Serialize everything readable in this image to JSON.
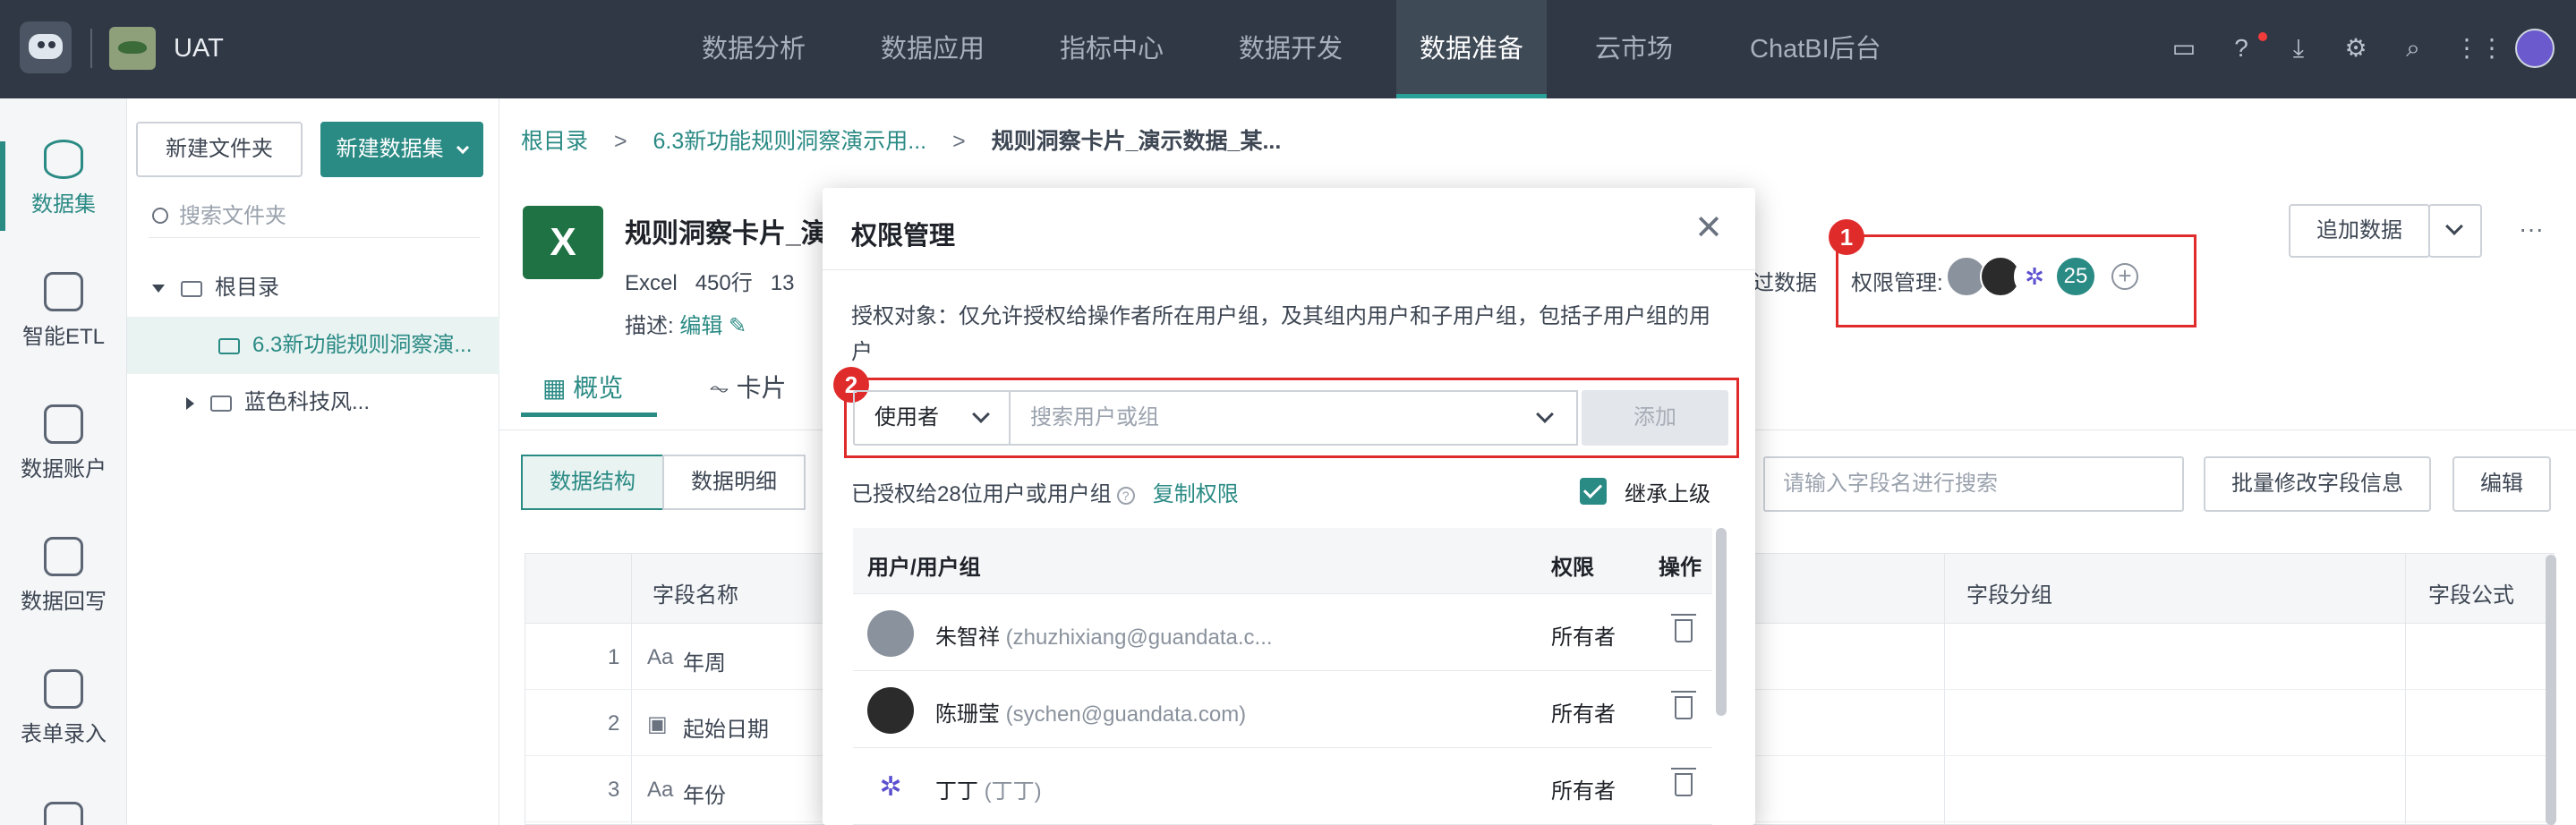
{
  "topbar": {
    "app_name": "UAT",
    "nav": [
      "数据分析",
      "数据应用",
      "指标中心",
      "数据开发",
      "数据准备",
      "云市场",
      "ChatBI后台"
    ],
    "active_nav": "数据准备",
    "icons": [
      "monitor-icon",
      "help-icon",
      "download-icon",
      "settings-icon",
      "search-icon",
      "apps-grid-icon",
      "user-avatar"
    ]
  },
  "sidebar": {
    "items": [
      "数据集",
      "智能ETL",
      "数据账户",
      "数据回写",
      "表单录入"
    ],
    "active": "数据集"
  },
  "tree": {
    "new_folder_button": "新建文件夹",
    "new_dataset_button": "新建数据集",
    "search_placeholder": "搜索文件夹",
    "nodes": [
      "根目录",
      "6.3新功能规则洞察演...",
      "蓝色科技风..."
    ]
  },
  "breadcrumb": {
    "root": "根目录",
    "sep": ">",
    "folder": "6.3新功能规则洞察演示用...",
    "current": "规则洞察卡片_演示数据_某..."
  },
  "dataset": {
    "title": "规则洞察卡片_演示",
    "type": "Excel",
    "rows": "450行",
    "extra": "13",
    "desc_label": "描述:",
    "edit_link": "编辑",
    "partial_right": "过数据"
  },
  "permission_summary": {
    "label": "权限管理:",
    "count": "25"
  },
  "actions": {
    "add_data": "追加数据",
    "more": "···",
    "batch_edit": "批量修改字段信息",
    "edit": "编辑",
    "field_search_placeholder": "请输入字段名进行搜索"
  },
  "tabs": [
    "概览",
    "卡片"
  ],
  "segments": [
    "数据结构",
    "数据明细"
  ],
  "field_table": {
    "headers": [
      "字段名称",
      "字段分组",
      "字段公式"
    ],
    "rows": [
      {
        "index": "1",
        "type": "Aa",
        "name": "年周"
      },
      {
        "index": "2",
        "type": "date",
        "name": "起始日期"
      },
      {
        "index": "3",
        "type": "Aa",
        "name": "年份"
      }
    ]
  },
  "markers": [
    "1",
    "2"
  ],
  "modal": {
    "title": "权限管理",
    "description": "授权对象：仅允许授权给操作者所在用户组，及其组内用户和子用户组，包括子用户组的用户",
    "subject_select": "使用者",
    "search_placeholder": "搜索用户或组",
    "add_button": "添加",
    "granted_text": "已授权给28位用户或用户组",
    "copy_link": "复制权限",
    "inherit_label": "继承上级",
    "inherit_checked": true,
    "table_headers": [
      "用户/用户组",
      "权限",
      "操作"
    ],
    "users": [
      {
        "name": "朱智祥",
        "email": "(zhuzhixiang@guandata.c...",
        "role": "所有者"
      },
      {
        "name": "陈珊莹",
        "email": "(sychen@guandata.com)",
        "role": "所有者"
      },
      {
        "name": "丁丁",
        "email": "(丁丁)",
        "role": "所有者"
      }
    ]
  },
  "colors": {
    "accent": "#2a8a84",
    "topbar": "#2f3844",
    "highlight": "#e02b2b"
  }
}
